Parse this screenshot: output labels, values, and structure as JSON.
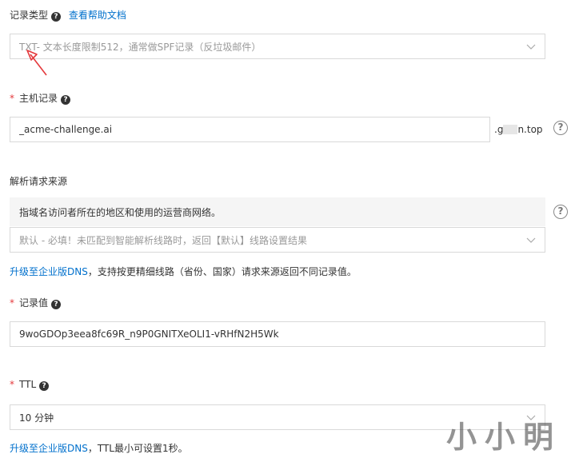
{
  "record_type": {
    "label": "记录类型",
    "help_link": "查看帮助文档",
    "value": "TXT- 文本长度限制512，通常做SPF记录（反垃圾邮件）"
  },
  "host_record": {
    "label": "主机记录",
    "value": "_acme-challenge.ai",
    "domain_suffix_start": ".g",
    "domain_suffix_end": "n.top"
  },
  "source": {
    "label": "解析请求来源",
    "hint": "指域名访问者所在的地区和使用的运营商网络。",
    "value": "默认 - 必填！未匹配到智能解析线路时，返回【默认】线路设置结果",
    "upgrade_link": "升级至企业版DNS",
    "upgrade_text": "，支持按更精细线路（省份、国家）请求来源返回不同记录值。"
  },
  "record_value": {
    "label": "记录值",
    "value": "9woGDOp3eea8fc69R_n9P0GNITXeOLI1-vRHfN2H5Wk"
  },
  "ttl": {
    "label": "TTL",
    "value": "10 分钟",
    "upgrade_link": "升级至企业版DNS",
    "upgrade_text": "，TTL最小可设置1秒。"
  },
  "watermark": "小小明",
  "icons": {
    "help": "?",
    "arrow_color": "#e4393c",
    "link_color": "#0070cc",
    "required_color": "#e4393c"
  }
}
